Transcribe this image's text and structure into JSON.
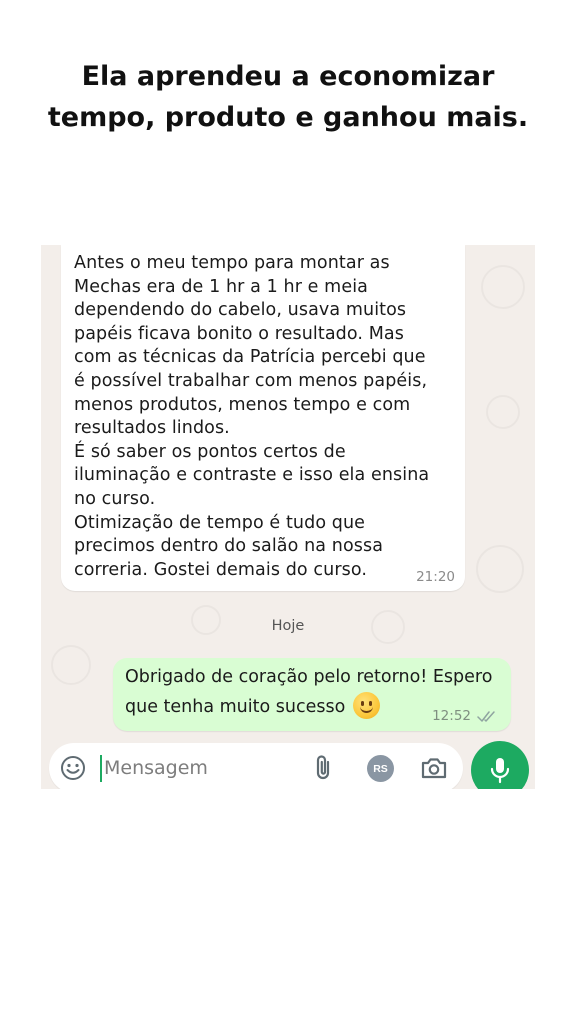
{
  "headline": {
    "line1": "Ela aprendeu a economizar",
    "line2": "tempo, produto e ganhou mais."
  },
  "chat": {
    "incoming_message": {
      "text": "Antes o meu tempo para montar as\nMechas era de 1 hr a 1 hr e meia\ndependendo do cabelo, usava muitos\npapéis ficava bonito o resultado. Mas\ncom as técnicas da Patrícia percebi que\né possível trabalhar com menos papéis,\nmenos produtos, menos tempo e com\nresultados lindos.\nÉ só saber os pontos certos de\niluminação e contraste e isso ela ensina\nno curso.\nOtimização de tempo é tudo que\nprecimos dentro do salão na nossa\ncorreria. Gostei demais do curso.",
      "time": "21:20"
    },
    "date_separator": "Hoje",
    "outgoing_message": {
      "text_line1": "Obrigado de coração pelo retorno! Espero",
      "text_line2": "que tenha muito sucesso",
      "emoji_icon": "slightly-smiling-face-emoji",
      "time": "12:52",
      "status_icon": "double-check-icon"
    }
  },
  "input_bar": {
    "placeholder": "Mensagem",
    "emoji_icon": "smiley-icon",
    "attach_icon": "paperclip-icon",
    "avatar_label": "RS",
    "camera_icon": "camera-icon",
    "mic_icon": "microphone-icon"
  },
  "colors": {
    "accent": "#1daa61",
    "outgoing_bubble": "#d9fdd3",
    "incoming_bubble": "#ffffff",
    "wallpaper": "#f3eeea"
  }
}
